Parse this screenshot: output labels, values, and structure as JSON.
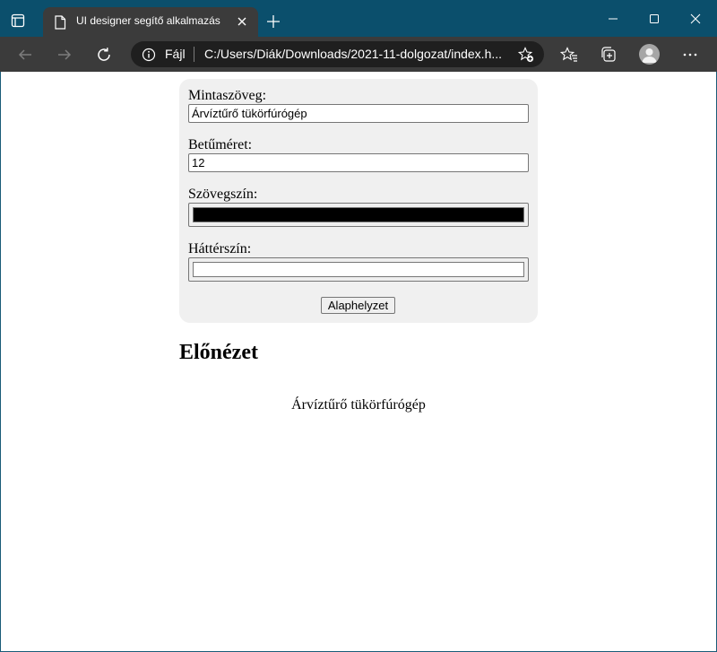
{
  "browser": {
    "tab_title": "UI designer segítő alkalmazás",
    "address_protocol": "Fájl",
    "address_url": "C:/Users/Diák/Downloads/2021-11-dolgozat/index.h..."
  },
  "icons": {
    "tab_actions": "tab-actions-icon",
    "page": "page-icon",
    "close_tab": "close-icon",
    "new_tab": "plus-icon",
    "minimize": "minimize-icon",
    "maximize": "maximize-icon",
    "close_window": "close-icon",
    "back": "arrow-left-icon",
    "forward": "arrow-right-icon",
    "refresh": "refresh-icon",
    "info": "info-icon",
    "add_favorite": "star-add-icon",
    "favorites": "favorites-icon",
    "collections": "collections-icon",
    "profile": "avatar",
    "menu": "ellipsis-icon"
  },
  "form": {
    "sample_label": "Mintaszöveg:",
    "sample_value": "Árvíztűrő tükörfúrógép",
    "fontsize_label": "Betűméret:",
    "fontsize_value": "12",
    "textcolor_label": "Szövegszín:",
    "textcolor_value": "#000000",
    "bgcolor_label": "Háttérszín:",
    "bgcolor_value": "#ffffff",
    "reset_label": "Alaphelyzet"
  },
  "preview": {
    "heading": "Előnézet",
    "text": "Árvíztűrő tükörfúrógép"
  },
  "colors": {
    "titlebar": "#0b4f6c",
    "toolbar": "#3b3b3b",
    "panel": "#f0f0f0"
  }
}
